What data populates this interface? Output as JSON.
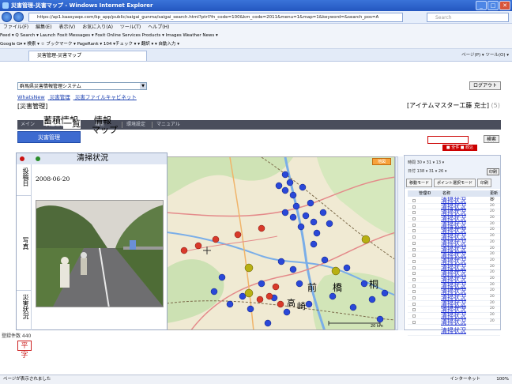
{
  "window": {
    "title": "災害管理-災害マップ - Windows Internet Explorer"
  },
  "address": {
    "url": "https://ap1.kaasyaqe.com/kp_app/public/saigai_gunma/saigai_search.html?ptrl?fn_code=100&km_code=2011&menu=1&map=1&keyword=&search_pos=A",
    "search_placeholder": "Search"
  },
  "menu": [
    "ファイル(F)",
    "編集(E)",
    "表示(V)",
    "お気に入り(A)",
    "ツール(T)",
    "ヘルプ(H)"
  ],
  "toolbars": {
    "feed": "Feed ▾   Q Search ▾   Launch   Foxit Messages ▾   Foxit Online Services   Products ▾   Images   Weather   News ▾",
    "google": "Google G▾           ▾ 検索 ▾ ☆ ブックマーク ▾ PageRank ▾ 104  ▾チェック ▾ ▾ 翻訳 ▾ ▾ 自動入力 ▾"
  },
  "tab": {
    "label": "災害管理-災害マップ",
    "tools": "ページ(P) ▾  ツール(O) ▾"
  },
  "page": {
    "system_select": "群馬県災害情報管理システム",
    "logout": "ログアウト",
    "links": [
      "WhatsNew",
      "災害管理",
      "災害ファイルキャビネット"
    ],
    "title": "[災害管理]",
    "user": "[アイテムマスター工藤 克士]",
    "user_count": "(5)",
    "nav": {
      "main": "メイン",
      "items": [
        "災害情報",
        "機能",
        "環境設定",
        "マニュアル"
      ]
    },
    "function_menu": "災害管理",
    "overlay_labels": {
      "a": "蓄積情報",
      "b": "一覧",
      "c": "情報",
      "d": "マップ"
    },
    "search_button": "検索",
    "red_label": "■ 全件  ■ 絞込"
  },
  "popup": {
    "title": "清掃状況",
    "labels": {
      "date": "投稿日",
      "photo": "写真",
      "condition": "災害状況"
    },
    "date": "2008-06-20"
  },
  "map": {
    "cities": [
      "前",
      "橋",
      "高",
      "崎",
      "桐"
    ],
    "scale": "20 km",
    "control": "地図"
  },
  "right_panel": {
    "form_rows": [
      "時間  30 ▾  31 ▾  13 ▾",
      "日付  138 ▾  31 ▾  26 ▾"
    ],
    "form_button": "印刷",
    "modes": [
      "移動モード",
      "ポイント選択モード",
      "印刷"
    ],
    "headers": {
      "id": "管理ID",
      "name": "名称",
      "updated": "更新日"
    },
    "rows": [
      {
        "name": "清掃状況",
        "num": "20"
      },
      {
        "name": "清掃状況",
        "num": "20"
      },
      {
        "name": "清掃状況",
        "num": "20"
      },
      {
        "name": "清掃状況",
        "num": "20"
      },
      {
        "name": "清掃状況",
        "num": "20"
      },
      {
        "name": "清掃状況",
        "num": "20"
      },
      {
        "name": "清掃状況",
        "num": "20"
      },
      {
        "name": "清掃状況",
        "num": "20"
      },
      {
        "name": "清掃状況",
        "num": "20"
      },
      {
        "name": "清掃状況",
        "num": "20"
      },
      {
        "name": "清掃状況",
        "num": "20"
      },
      {
        "name": "清掃状況",
        "num": "20"
      },
      {
        "name": "清掃状況",
        "num": "20"
      },
      {
        "name": "清掃状況",
        "num": "20"
      },
      {
        "name": "清掃状況",
        "num": "20"
      },
      {
        "name": "清掃状況",
        "num": "20"
      },
      {
        "name": "清掃状況",
        "num": "20"
      },
      {
        "name": "清掃状況",
        "num": "20"
      },
      {
        "name": "清掃状況",
        "num": "20"
      },
      {
        "name": "清掃状況",
        "num": "20"
      },
      {
        "name": "清掃状況",
        "num": "20"
      }
    ],
    "last_row": "清掃状況"
  },
  "footer": {
    "count": "登録件数 440",
    "stamp": "平字",
    "status_left": "ページが表示されました",
    "status_right": "インターネット",
    "zoom": "100%"
  },
  "colors": {
    "blue_marker": "#2a48d8",
    "red_marker": "#d83a2a",
    "yellow_marker": "#b8b012",
    "link": "#1c2fd0"
  }
}
